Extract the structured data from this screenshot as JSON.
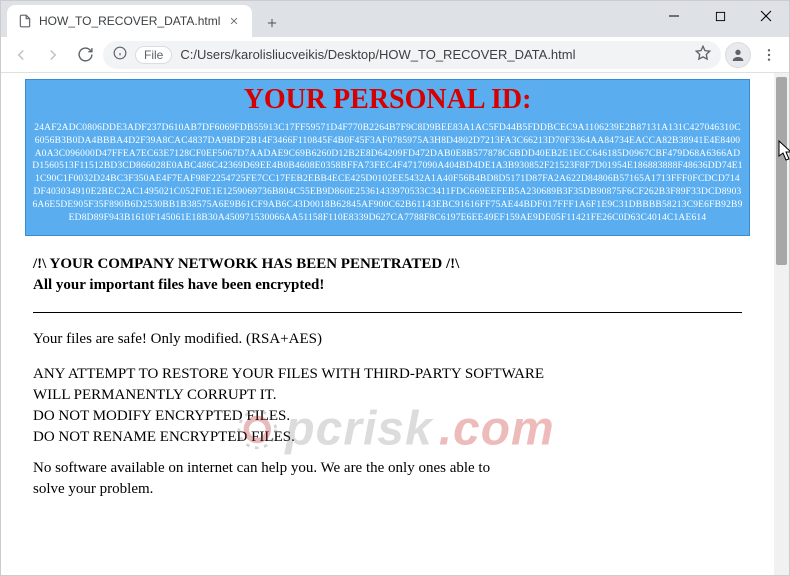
{
  "tab": {
    "title": "HOW_TO_RECOVER_DATA.html"
  },
  "omnibox": {
    "scheme_label": "File",
    "url": "C:/Users/karolisliucveikis/Desktop/HOW_TO_RECOVER_DATA.html"
  },
  "page": {
    "header": "YOUR PERSONAL ID:",
    "personal_id": "24AF2ADC0806DDE3ADF237D610AB7DF6069FDB55913C17FF59571D4F770B2264B7F9C8D9BEE83A1AC5FD44B5FDDBCEC9A1106239E2B87131A131C427046310C6056B3B0DA4BBBA4D2F39A8CAC4837DA9BDF2B14F3466F110845F4B0F45F3AF0785975A3H8D4802D7213FA3C66213D70F3364AA84734EACCA82B38941E4E8400A0A3C096000D47FFEA7EC63E7128CF0EF5067D7AADAE9C69B6260D12B2E8D64209FD472DAB0E8B577878C6BDD40EB2E1ECC646185D0967CBF479D68A6366ADD1560513F11512BD3CD866028E0ABC486C42369D69EE4B0B4608E0358BFFA73FEC4F4717090A404BD4DE1A3B930852F21523F8F7D01954E186883888F48636DD74E11C90C1F0032D24BC3F350AE4F7EAF98F2254725FE7CC17FEB2EBB4ECE425D0102EE5432A1A40F56B4BD8D5171D87FA2A622D84806B57165A1713FFF0FCDCD714DF403034910E2BEC2AC1495021C052F0E1E1259069736B804C55EB9D860E25361433970533C3411FDC669EEFEB5A230689B3F35DB90875F6CF262B3F89F33DCD89036A6E5DE905F35F890B6D2530BB1B38575A6E9B61CF9AB6C43D0018B62845AF900C62B61143EBC91616FF75AE44BDF017FFF1A6F1E9C31DBBBB58213C9E6FB92B9ED8D89F943B1610F145061E18B30A450971530066AA51158F110E8339D627CA7788F8C6197E6EE49EF159AE9DE05F11421FE26C0D63C4014C1AE614",
    "warn1": "/!\\ YOUR COMPANY NETWORK HAS BEEN PENETRATED /!\\",
    "warn2": "All your important files have been encrypted!",
    "safe_line": "Your files are safe! Only modified. (RSA+AES)",
    "l1": "ANY ATTEMPT TO RESTORE YOUR FILES WITH THIRD-PARTY SOFTWARE",
    "l2": "WILL PERMANENTLY CORRUPT IT.",
    "l3": "DO NOT MODIFY ENCRYPTED FILES.",
    "l4": "DO NOT RENAME ENCRYPTED FILES.",
    "l5": "No software available on internet can help you. We are the only ones able to",
    "l6": "solve your problem."
  },
  "watermark": {
    "text1": "pcrisk",
    "text2": ".com"
  }
}
